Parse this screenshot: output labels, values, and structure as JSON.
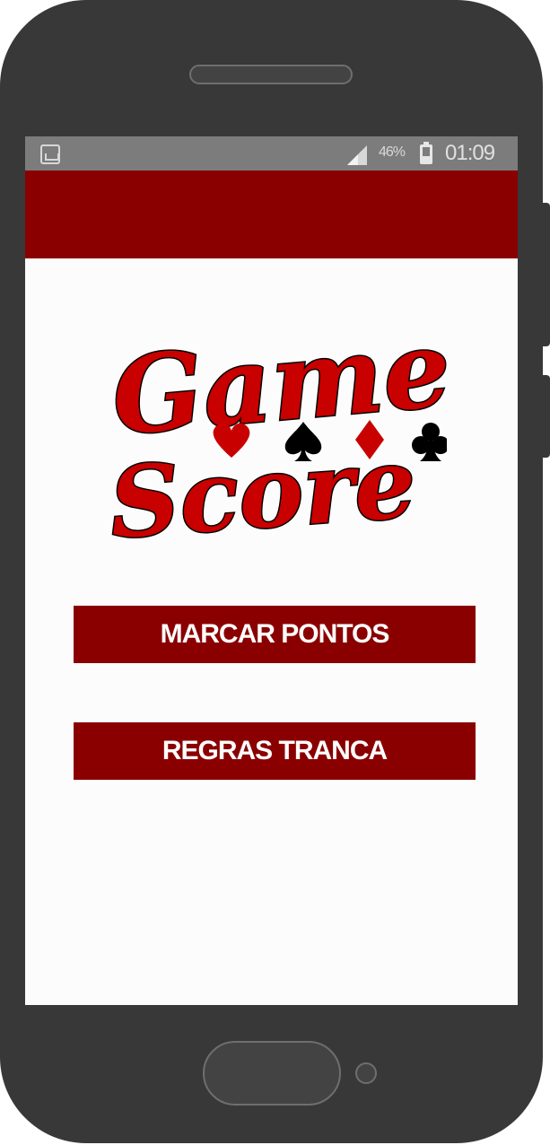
{
  "status_bar": {
    "app_icon": "screenshot-notification-icon",
    "signal_icon": "cell-signal-icon",
    "battery_percent": "46%",
    "battery_icon": "battery-icon",
    "time": "01:09"
  },
  "app_bar": {
    "color": "#8a0000"
  },
  "logo": {
    "line1": "Game",
    "line2": "Score",
    "suits": [
      "heart-icon",
      "spade-icon",
      "diamond-icon",
      "club-icon"
    ],
    "colors": {
      "red": "#c80000",
      "black": "#000000"
    }
  },
  "menu": {
    "score_label": "MARCAR PONTOS",
    "rules_label": "REGRAS TRANCA",
    "button_color": "#8a0000"
  },
  "device": {
    "body_color": "#383838"
  }
}
